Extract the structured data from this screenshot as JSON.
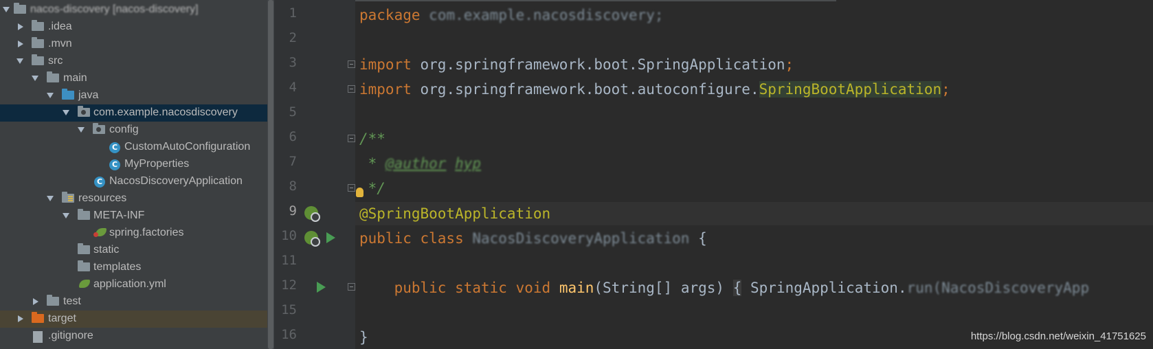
{
  "project_tree": {
    "root_label": "nacos-discovery [nacos-discovery]",
    "items": [
      {
        "label": ".idea",
        "type": "folder",
        "expanded": false
      },
      {
        "label": ".mvn",
        "type": "folder",
        "expanded": false
      },
      {
        "label": "src",
        "type": "folder",
        "expanded": true
      },
      {
        "label": "main",
        "type": "folder",
        "expanded": true
      },
      {
        "label": "java",
        "type": "source-folder",
        "expanded": true
      },
      {
        "label": "com.example.nacosdiscovery",
        "type": "package",
        "expanded": true,
        "selected": true
      },
      {
        "label": "config",
        "type": "package",
        "expanded": true
      },
      {
        "label": "CustomAutoConfiguration",
        "type": "class"
      },
      {
        "label": "MyProperties",
        "type": "class"
      },
      {
        "label": "NacosDiscoveryApplication",
        "type": "spring-boot-class"
      },
      {
        "label": "resources",
        "type": "resources-folder",
        "expanded": true
      },
      {
        "label": "META-INF",
        "type": "folder",
        "expanded": true
      },
      {
        "label": "spring.factories",
        "type": "spring-factories-file"
      },
      {
        "label": "static",
        "type": "folder"
      },
      {
        "label": "templates",
        "type": "folder"
      },
      {
        "label": "application.yml",
        "type": "yml-file"
      },
      {
        "label": "test",
        "type": "folder",
        "expanded": false
      },
      {
        "label": "target",
        "type": "excluded-folder",
        "expanded": false
      },
      {
        "label": ".gitignore",
        "type": "file"
      }
    ]
  },
  "editor": {
    "line_numbers": [
      "1",
      "2",
      "3",
      "4",
      "5",
      "6",
      "7",
      "8",
      "9",
      "10",
      "11",
      "12",
      "15",
      "16"
    ],
    "current_line": "9",
    "code": {
      "l1_kw": "package",
      "l1_rest": "com.example.nacosdiscovery;",
      "l3_kw": "import",
      "l3_rest": "org.springframework.boot.SpringApplication",
      "l3_semi": ";",
      "l4_kw": "import",
      "l4_rest": "org.springframework.boot.autoconfigure.",
      "l4_hl": "SpringBootApplication",
      "l4_semi": ";",
      "l6": "/**",
      "l7_star": " * ",
      "l7_tag": "@author",
      "l7_name": "hyp",
      "l8": " */",
      "l9": "@SpringBootApplication",
      "l10_kw": "public class",
      "l10_name": "NacosDiscoveryApplication",
      "l10_brace": "{",
      "l12_kw": "public static void",
      "l12_fn": "main",
      "l12_args": "(String[] args)",
      "l12_brace": "{",
      "l12_call": "SpringApplication.",
      "l12_blur": "run(NacosDiscoveryApp",
      "l16": "}"
    }
  },
  "watermark": "https://blog.csdn.net/weixin_41751625",
  "colors": {
    "keyword": "#cc7832",
    "annotation": "#bbb529",
    "comment": "#629755",
    "function": "#ffc66d",
    "default_text": "#a9b7c6",
    "selection": "#0d293e"
  },
  "icons": [
    "folder-icon",
    "package-icon",
    "class-icon",
    "spring-boot-icon",
    "spring-factories-icon",
    "yml-icon",
    "run-icon",
    "bean-icon",
    "lightbulb-icon",
    "fold-marker-icon"
  ]
}
